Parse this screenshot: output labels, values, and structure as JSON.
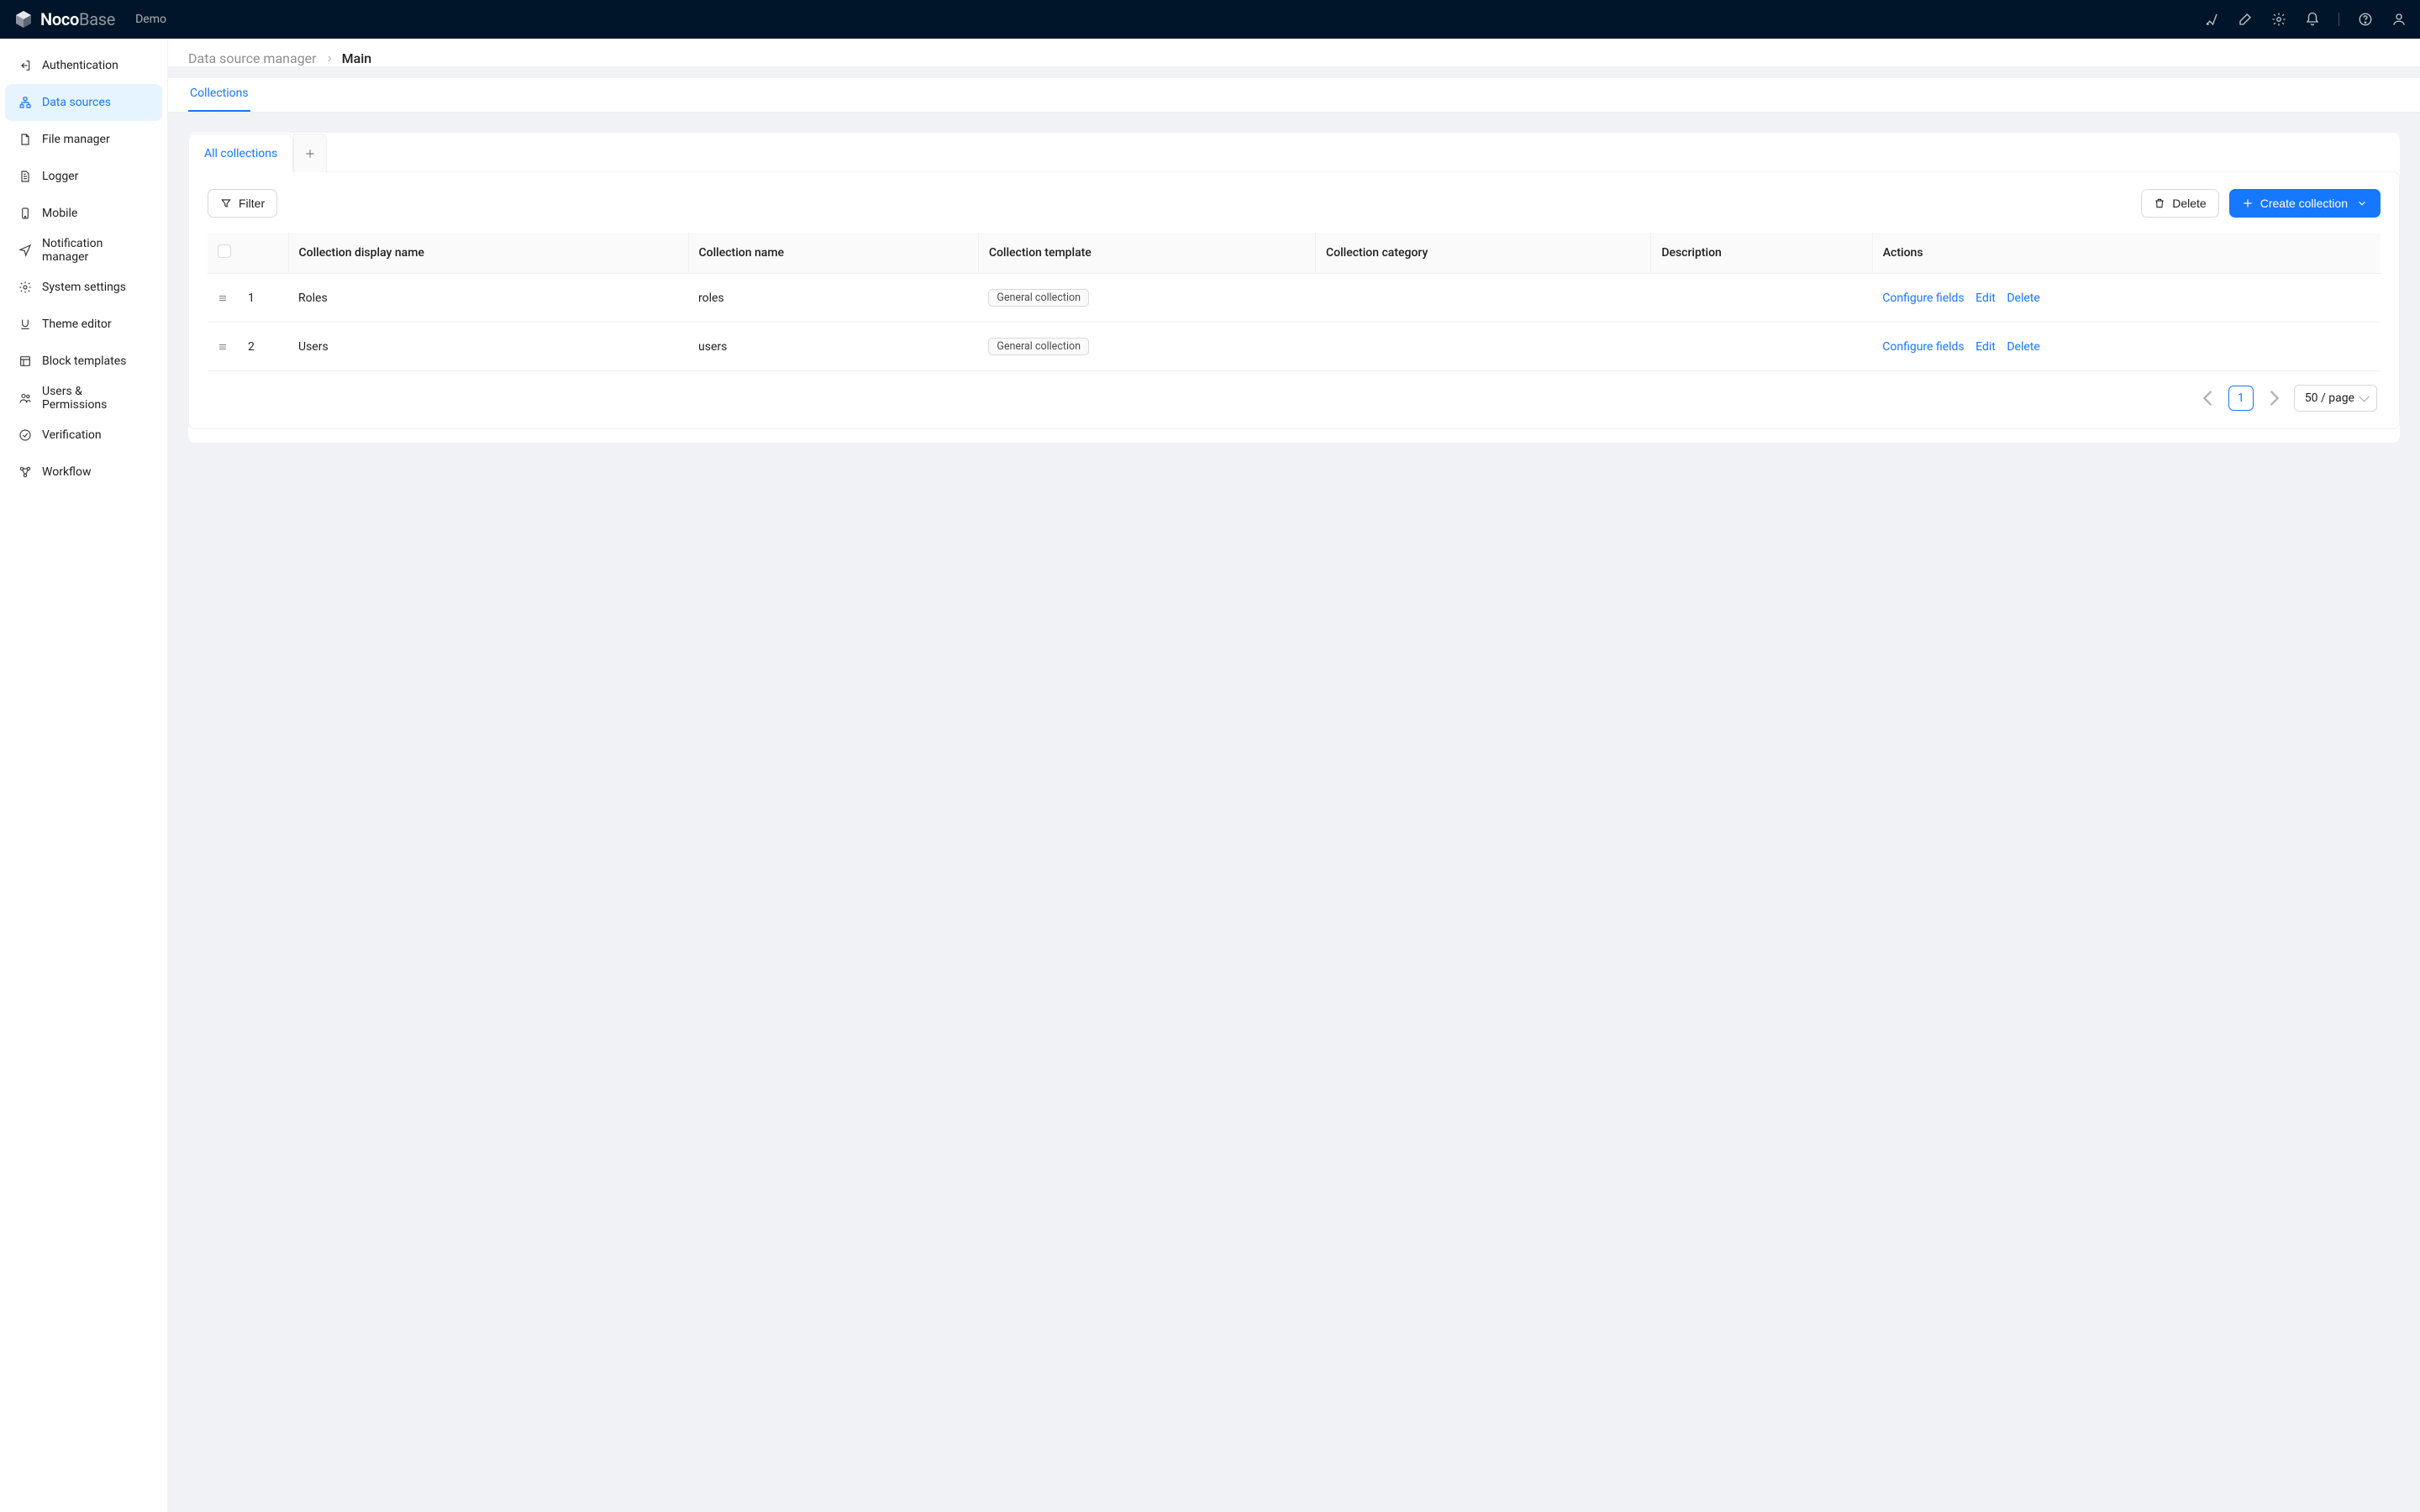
{
  "brand": {
    "main": "Noco",
    "sub": "Base"
  },
  "topbar": {
    "demo": "Demo"
  },
  "sidebar": {
    "items": [
      {
        "label": "Authentication"
      },
      {
        "label": "Data sources"
      },
      {
        "label": "File manager"
      },
      {
        "label": "Logger"
      },
      {
        "label": "Mobile"
      },
      {
        "label": "Notification manager"
      },
      {
        "label": "System settings"
      },
      {
        "label": "Theme editor"
      },
      {
        "label": "Block templates"
      },
      {
        "label": "Users & Permissions"
      },
      {
        "label": "Verification"
      },
      {
        "label": "Workflow"
      }
    ],
    "active_index": 1
  },
  "breadcrumb": {
    "parent": "Data source manager",
    "current": "Main"
  },
  "subtab": {
    "label": "Collections"
  },
  "cardTabs": {
    "all": "All collections"
  },
  "toolbar": {
    "filter": "Filter",
    "delete": "Delete",
    "create": "Create collection"
  },
  "table": {
    "headers": {
      "display_name": "Collection display name",
      "name": "Collection name",
      "template": "Collection template",
      "category": "Collection category",
      "description": "Description",
      "actions": "Actions"
    },
    "actions": {
      "configure": "Configure fields",
      "edit": "Edit",
      "delete": "Delete"
    },
    "rows": [
      {
        "idx": "1",
        "display_name": "Roles",
        "name": "roles",
        "template": "General collection",
        "category": "",
        "description": ""
      },
      {
        "idx": "2",
        "display_name": "Users",
        "name": "users",
        "template": "General collection",
        "category": "",
        "description": ""
      }
    ]
  },
  "pagination": {
    "current": "1",
    "page_size_label": "50 / page"
  }
}
